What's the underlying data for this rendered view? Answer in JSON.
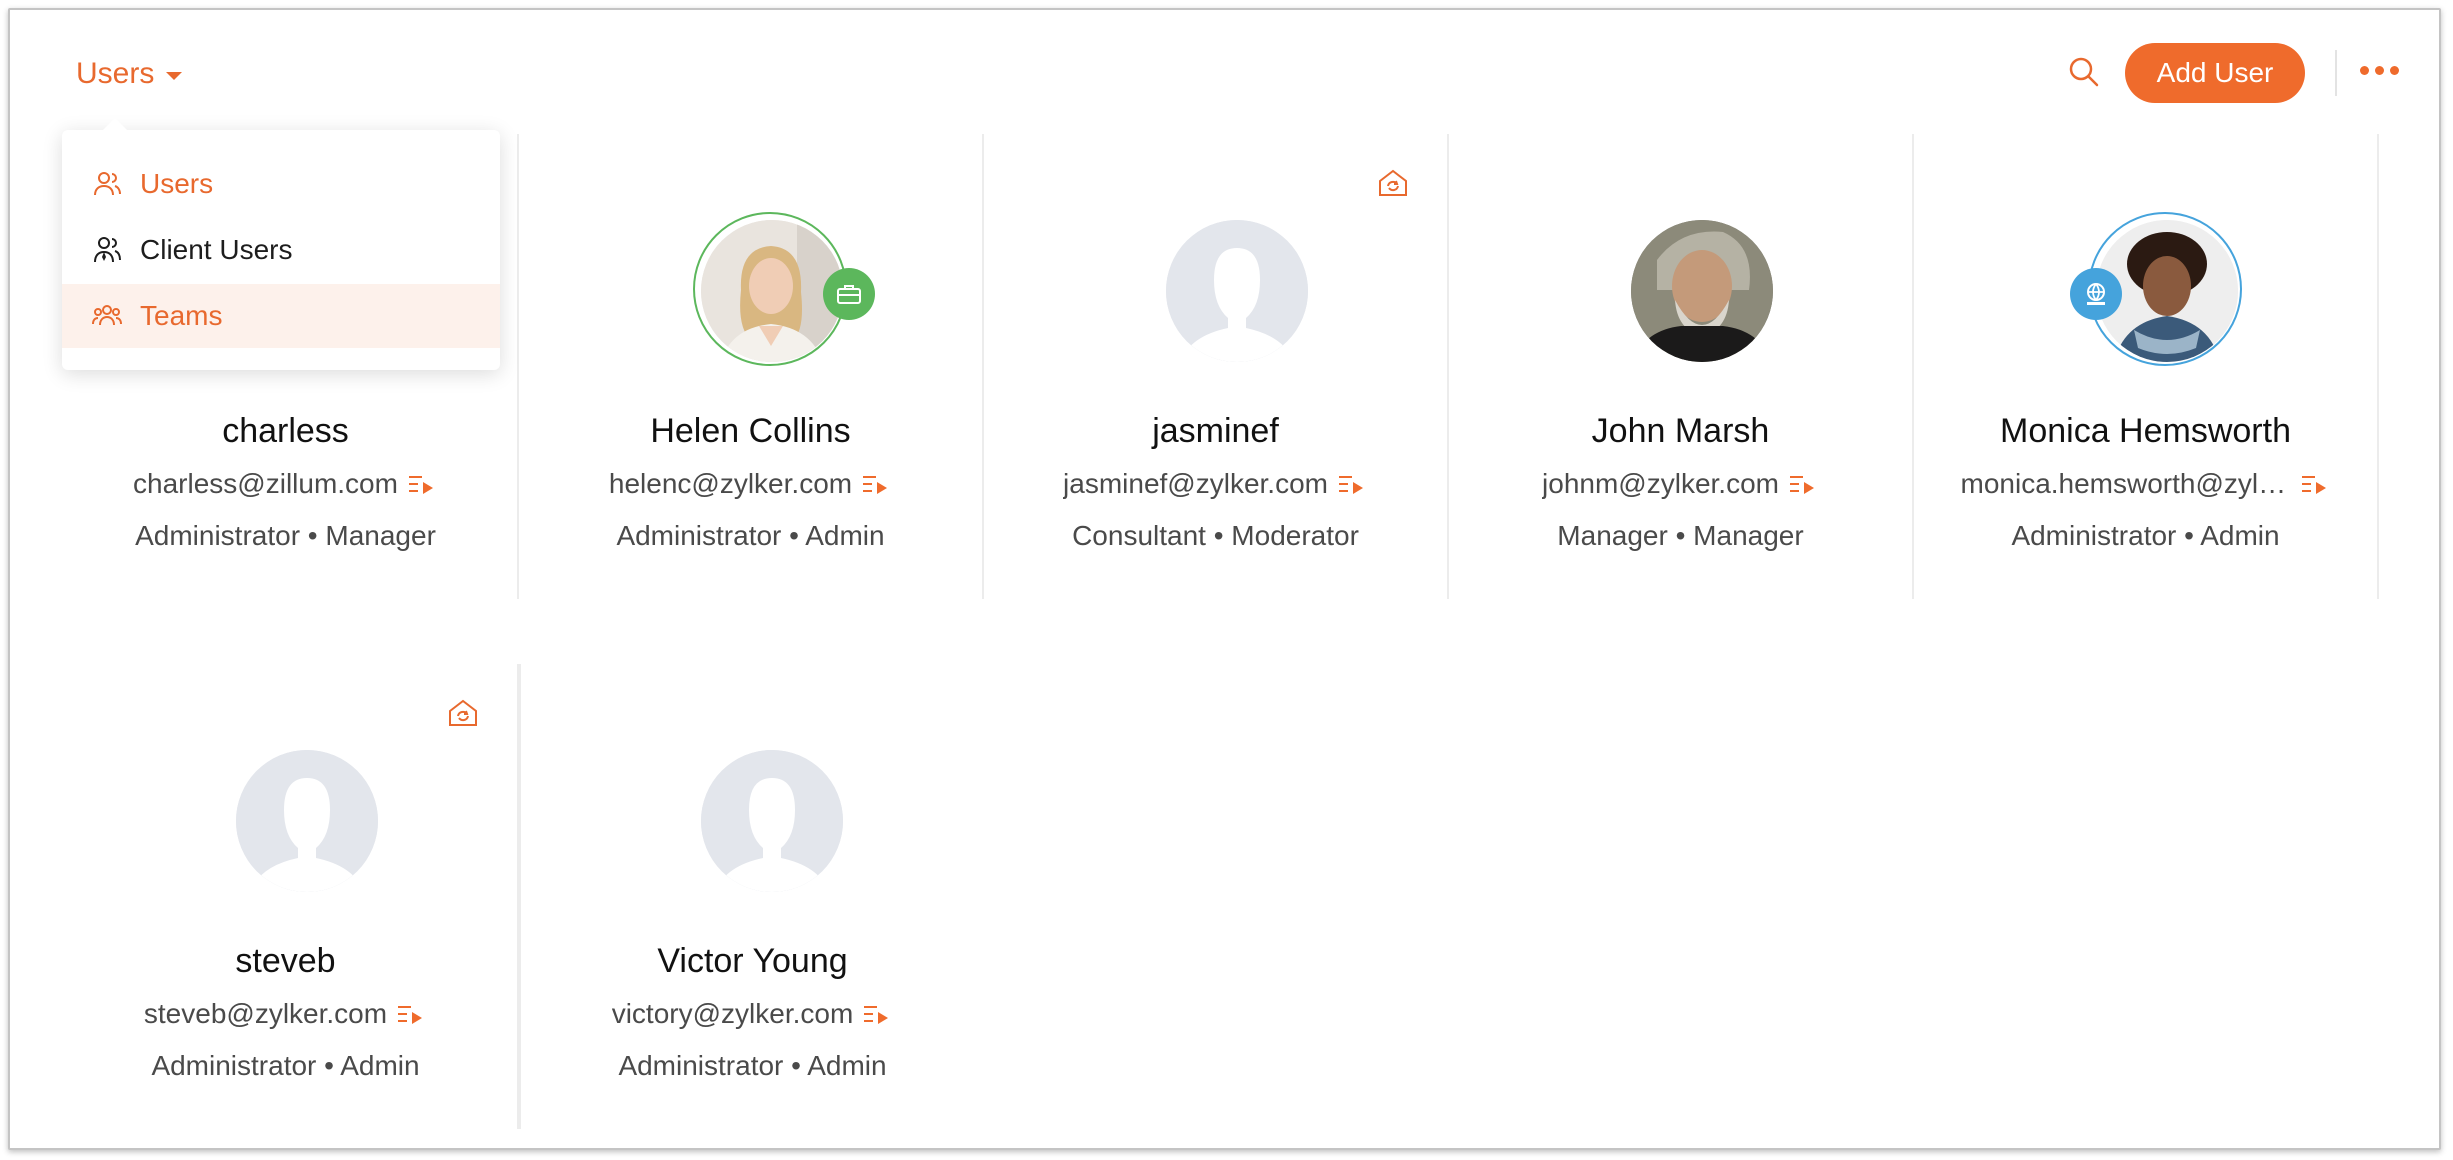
{
  "header": {
    "title": "Users",
    "add_user_label": "Add User",
    "icons": [
      "search-icon",
      "more-icon"
    ]
  },
  "dropdown": {
    "items": [
      {
        "label": "Users",
        "icon": "user-icon",
        "state": "active"
      },
      {
        "label": "Client Users",
        "icon": "client-users-icon",
        "state": "normal"
      },
      {
        "label": "Teams",
        "icon": "teams-icon",
        "state": "hover"
      }
    ]
  },
  "users": [
    {
      "name": "charless",
      "email": "charless@zillum.com",
      "role": "Administrator • Manager",
      "avatar": "hidden"
    },
    {
      "name": "Helen Collins",
      "email": "helenc@zylker.com",
      "role": "Administrator • Admin",
      "avatar": "photo",
      "badge": "briefcase-icon"
    },
    {
      "name": "jasminef",
      "email": "jasminef@zylker.com",
      "role": "Consultant • Moderator",
      "avatar": "placeholder",
      "corner_icon": "home-sync-icon"
    },
    {
      "name": "John Marsh",
      "email": "johnm@zylker.com",
      "role": "Manager • Manager",
      "avatar": "photo"
    },
    {
      "name": "Monica Hemsworth",
      "email": "monica.hemsworth@zylk…",
      "role": "Administrator • Admin",
      "avatar": "photo",
      "badge": "globe-icon"
    },
    {
      "name": "steveb",
      "email": "steveb@zylker.com",
      "role": "Administrator • Admin",
      "avatar": "placeholder",
      "corner_icon": "home-sync-icon"
    },
    {
      "name": "Victor Young",
      "email": "victory@zylker.com",
      "role": "Administrator • Admin",
      "avatar": "placeholder"
    }
  ],
  "colors": {
    "accent": "#ef6b2c",
    "green_badge": "#5cb75c",
    "blue_badge": "#45a3dc",
    "placeholder": "#e3e6ec"
  }
}
